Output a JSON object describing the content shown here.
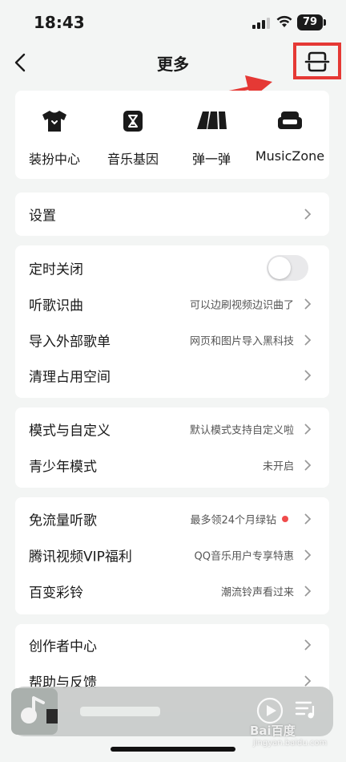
{
  "status_bar": {
    "time": "18:43",
    "battery": "79"
  },
  "nav": {
    "title": "更多",
    "back_icon": "chevron-left-icon",
    "scan_icon": "scan-icon"
  },
  "shortcuts": [
    {
      "label": "装扮中心",
      "icon": "tshirt-icon"
    },
    {
      "label": "音乐基因",
      "icon": "hourglass-icon"
    },
    {
      "label": "弹一弹",
      "icon": "piano-keys-icon"
    },
    {
      "label": "MusicZone",
      "icon": "sofa-icon"
    }
  ],
  "sections": [
    {
      "rows": [
        {
          "title": "设置",
          "subtitle": ""
        }
      ]
    },
    {
      "rows": [
        {
          "title": "定时关闭",
          "subtitle": "",
          "toggle": false
        },
        {
          "title": "听歌识曲",
          "subtitle": "可以边刷视频边识曲了"
        },
        {
          "title": "导入外部歌单",
          "subtitle": "网页和图片导入黑科技"
        },
        {
          "title": "清理占用空间",
          "subtitle": ""
        }
      ]
    },
    {
      "rows": [
        {
          "title": "模式与自定义",
          "subtitle": "默认模式支持自定义啦"
        },
        {
          "title": "青少年模式",
          "subtitle": "未开启"
        }
      ]
    },
    {
      "rows": [
        {
          "title": "免流量听歌",
          "subtitle": "最多领24个月绿钻",
          "dot": true
        },
        {
          "title": "腾讯视频VIP福利",
          "subtitle": "QQ音乐用户专享特惠"
        },
        {
          "title": "百变彩铃",
          "subtitle": "潮流铃声看过来"
        }
      ]
    },
    {
      "rows": [
        {
          "title": "创作者中心",
          "subtitle": ""
        },
        {
          "title": "帮助与反馈",
          "subtitle": ""
        }
      ]
    }
  ],
  "player": {
    "play_icon": "play-circle-icon",
    "queue_icon": "playlist-icon"
  },
  "watermark": {
    "logo": "Bai百度",
    "sub": "jingyan.baidu.com"
  },
  "colors": {
    "highlight": "#e53935",
    "red_dot": "#f04b4b",
    "background": "#f3f5f4"
  }
}
